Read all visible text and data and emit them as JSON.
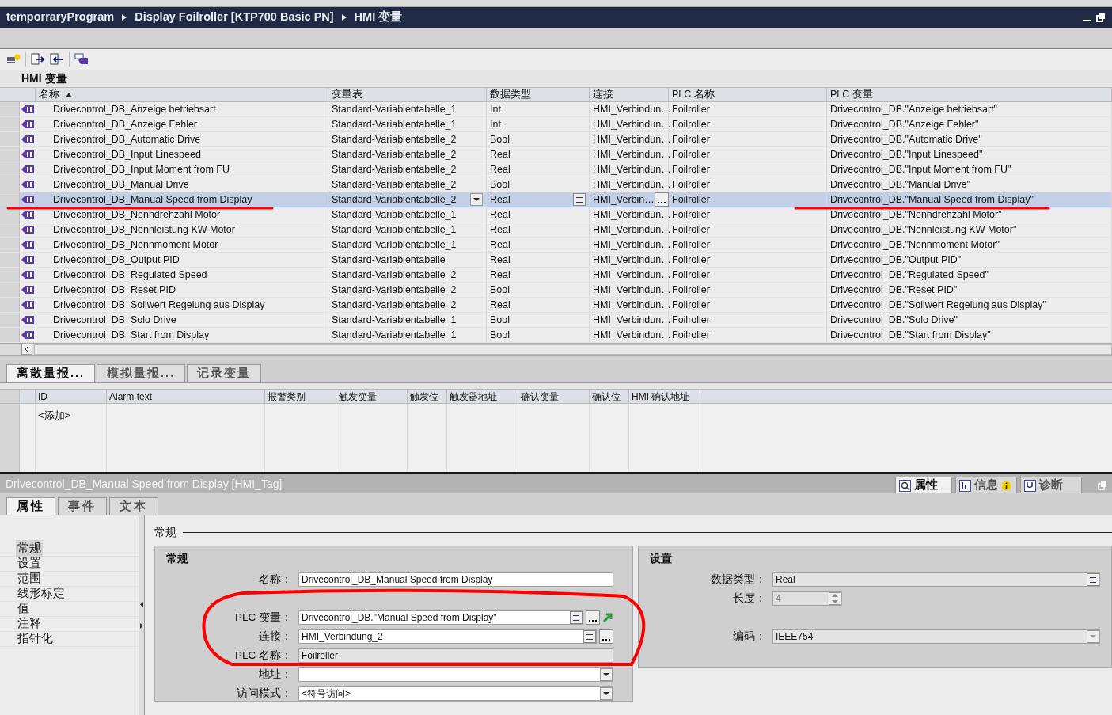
{
  "breadcrumb": [
    "temporraryProgram",
    "Display Foilroller [KTP700 Basic PN]",
    "HMI 变量"
  ],
  "editor": {
    "title": "HMI 变量",
    "columns": [
      {
        "label": "名称",
        "sorted": true
      },
      {
        "label": "变量表",
        "sorted": false
      },
      {
        "label": "数据类型",
        "sorted": false
      },
      {
        "label": "连接",
        "sorted": false
      },
      {
        "label": "PLC 名称",
        "sorted": false
      },
      {
        "label": "PLC 变量",
        "sorted": false
      }
    ],
    "rows": [
      {
        "name": "Drivecontrol_DB_Anzeige betriebsart",
        "table": "Standard-Variablentabelle_1",
        "type": "Int",
        "connection": "HMI_Verbindun…",
        "plc_name": "Foilroller",
        "plc_tag": "Drivecontrol_DB.\"Anzeige betriebsart\"",
        "selected": false
      },
      {
        "name": "Drivecontrol_DB_Anzeige Fehler",
        "table": "Standard-Variablentabelle_1",
        "type": "Int",
        "connection": "HMI_Verbindun…",
        "plc_name": "Foilroller",
        "plc_tag": "Drivecontrol_DB.\"Anzeige Fehler\"",
        "selected": false
      },
      {
        "name": "Drivecontrol_DB_Automatic Drive",
        "table": "Standard-Variablentabelle_2",
        "type": "Bool",
        "connection": "HMI_Verbindun…",
        "plc_name": "Foilroller",
        "plc_tag": "Drivecontrol_DB.\"Automatic Drive\"",
        "selected": false
      },
      {
        "name": "Drivecontrol_DB_Input Linespeed",
        "table": "Standard-Variablentabelle_2",
        "type": "Real",
        "connection": "HMI_Verbindun…",
        "plc_name": "Foilroller",
        "plc_tag": "Drivecontrol_DB.\"Input Linespeed\"",
        "selected": false
      },
      {
        "name": "Drivecontrol_DB_Input Moment from FU",
        "table": "Standard-Variablentabelle_2",
        "type": "Real",
        "connection": "HMI_Verbindun…",
        "plc_name": "Foilroller",
        "plc_tag": "Drivecontrol_DB.\"Input Moment from FU\"",
        "selected": false
      },
      {
        "name": "Drivecontrol_DB_Manual Drive",
        "table": "Standard-Variablentabelle_2",
        "type": "Bool",
        "connection": "HMI_Verbindun…",
        "plc_name": "Foilroller",
        "plc_tag": "Drivecontrol_DB.\"Manual Drive\"",
        "selected": false
      },
      {
        "name": "Drivecontrol_DB_Manual Speed from Display",
        "table": "Standard-Variablentabelle_2",
        "type": "Real",
        "connection": "HMI_Verbin…",
        "plc_name": "Foilroller",
        "plc_tag": "Drivecontrol_DB.\"Manual Speed from Display\"",
        "selected": true
      },
      {
        "name": "Drivecontrol_DB_Nenndrehzahl Motor",
        "table": "Standard-Variablentabelle_1",
        "type": "Real",
        "connection": "HMI_Verbindun…",
        "plc_name": "Foilroller",
        "plc_tag": "Drivecontrol_DB.\"Nenndrehzahl Motor\"",
        "selected": false
      },
      {
        "name": "Drivecontrol_DB_Nennleistung KW Motor",
        "table": "Standard-Variablentabelle_1",
        "type": "Real",
        "connection": "HMI_Verbindun…",
        "plc_name": "Foilroller",
        "plc_tag": "Drivecontrol_DB.\"Nennleistung KW Motor\"",
        "selected": false
      },
      {
        "name": "Drivecontrol_DB_Nennmoment Motor",
        "table": "Standard-Variablentabelle_1",
        "type": "Real",
        "connection": "HMI_Verbindun…",
        "plc_name": "Foilroller",
        "plc_tag": "Drivecontrol_DB.\"Nennmoment Motor\"",
        "selected": false
      },
      {
        "name": "Drivecontrol_DB_Output PID",
        "table": "Standard-Variablentabelle",
        "type": "Real",
        "connection": "HMI_Verbindun…",
        "plc_name": "Foilroller",
        "plc_tag": "Drivecontrol_DB.\"Output PID\"",
        "selected": false
      },
      {
        "name": "Drivecontrol_DB_Regulated Speed",
        "table": "Standard-Variablentabelle_2",
        "type": "Real",
        "connection": "HMI_Verbindun…",
        "plc_name": "Foilroller",
        "plc_tag": "Drivecontrol_DB.\"Regulated Speed\"",
        "selected": false
      },
      {
        "name": "Drivecontrol_DB_Reset PID",
        "table": "Standard-Variablentabelle_2",
        "type": "Bool",
        "connection": "HMI_Verbindun…",
        "plc_name": "Foilroller",
        "plc_tag": "Drivecontrol_DB.\"Reset PID\"",
        "selected": false
      },
      {
        "name": "Drivecontrol_DB_Sollwert Regelung aus Display",
        "table": "Standard-Variablentabelle_2",
        "type": "Real",
        "connection": "HMI_Verbindun…",
        "plc_name": "Foilroller",
        "plc_tag": "Drivecontrol_DB.\"Sollwert Regelung aus Display\"",
        "selected": false
      },
      {
        "name": "Drivecontrol_DB_Solo Drive",
        "table": "Standard-Variablentabelle_1",
        "type": "Bool",
        "connection": "HMI_Verbindun…",
        "plc_name": "Foilroller",
        "plc_tag": "Drivecontrol_DB.\"Solo Drive\"",
        "selected": false
      },
      {
        "name": "Drivecontrol_DB_Start from Display",
        "table": "Standard-Variablentabelle_1",
        "type": "Bool",
        "connection": "HMI_Verbindun…",
        "plc_name": "Foilroller",
        "plc_tag": "Drivecontrol_DB.\"Start from Display\"",
        "selected": false
      }
    ]
  },
  "alarms": {
    "tabs": [
      {
        "label": "离散量报...",
        "selected": true
      },
      {
        "label": "模拟量报...",
        "selected": false
      },
      {
        "label": "记录变量",
        "selected": false
      }
    ],
    "columns": [
      "ID",
      "Alarm text",
      "报警类别",
      "触发变量",
      "触发位",
      "触发器地址",
      "确认变量",
      "确认位",
      "HMI 确认地址"
    ],
    "add_row": "<添加>"
  },
  "inspector": {
    "title": "Drivecontrol_DB_Manual Speed from Display [HMI_Tag]",
    "view_tabs": [
      {
        "label": "属性",
        "kind": "properties",
        "selected": true
      },
      {
        "label": "信息",
        "kind": "info",
        "selected": false
      },
      {
        "label": "诊断",
        "kind": "diagnostics",
        "selected": false
      }
    ],
    "tabs": [
      {
        "label": "属性",
        "selected": true
      },
      {
        "label": "事件",
        "selected": false
      },
      {
        "label": "文本",
        "selected": false
      }
    ],
    "nav": [
      {
        "label": "常规",
        "selected": true
      },
      {
        "label": "设置",
        "selected": false
      },
      {
        "label": "范围",
        "selected": false
      },
      {
        "label": "线形标定",
        "selected": false
      },
      {
        "label": "值",
        "selected": false
      },
      {
        "label": "注释",
        "selected": false
      },
      {
        "label": "指针化",
        "selected": false
      }
    ],
    "section": "常规",
    "general": {
      "title": "常规",
      "fields": [
        {
          "label": "名称：",
          "value": "Drivecontrol_DB_Manual Speed from Display",
          "kind": "text"
        },
        {
          "label": "PLC 变量：",
          "value": "Drivecontrol_DB.\"Manual Speed from Display\"",
          "kind": "tag"
        },
        {
          "label": "连接：",
          "value": "HMI_Verbindung_2",
          "kind": "browse"
        },
        {
          "label": "PLC 名称：",
          "value": "Foilroller",
          "kind": "readonly"
        },
        {
          "label": "地址：",
          "kind": "select"
        },
        {
          "label": "访问模式：",
          "value": "<符号访问>",
          "kind": "select"
        }
      ]
    },
    "settings": {
      "title": "设置",
      "fields": [
        {
          "label": "数据类型：",
          "value": "Real",
          "kind": "list"
        },
        {
          "label": "长度：",
          "value": "4",
          "kind": "spin",
          "disabled": true
        },
        {
          "label": "编码：",
          "value": "IEEE754",
          "kind": "select_disabled"
        }
      ]
    }
  }
}
